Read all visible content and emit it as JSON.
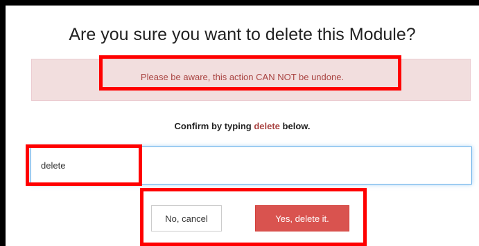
{
  "dialog": {
    "title": "Are you sure you want to delete this Module?",
    "warning": "Please be aware, this action CAN NOT be undone.",
    "confirm_prefix": "Confirm by typing ",
    "confirm_word": "delete",
    "confirm_suffix": " below.",
    "input_value": "delete",
    "cancel_label": "No, cancel",
    "delete_label": "Yes, delete it."
  },
  "colors": {
    "warning_background": "#f2dede",
    "warning_text": "#a94442",
    "delete_button": "#d9534f",
    "highlight": "#ff0000"
  }
}
